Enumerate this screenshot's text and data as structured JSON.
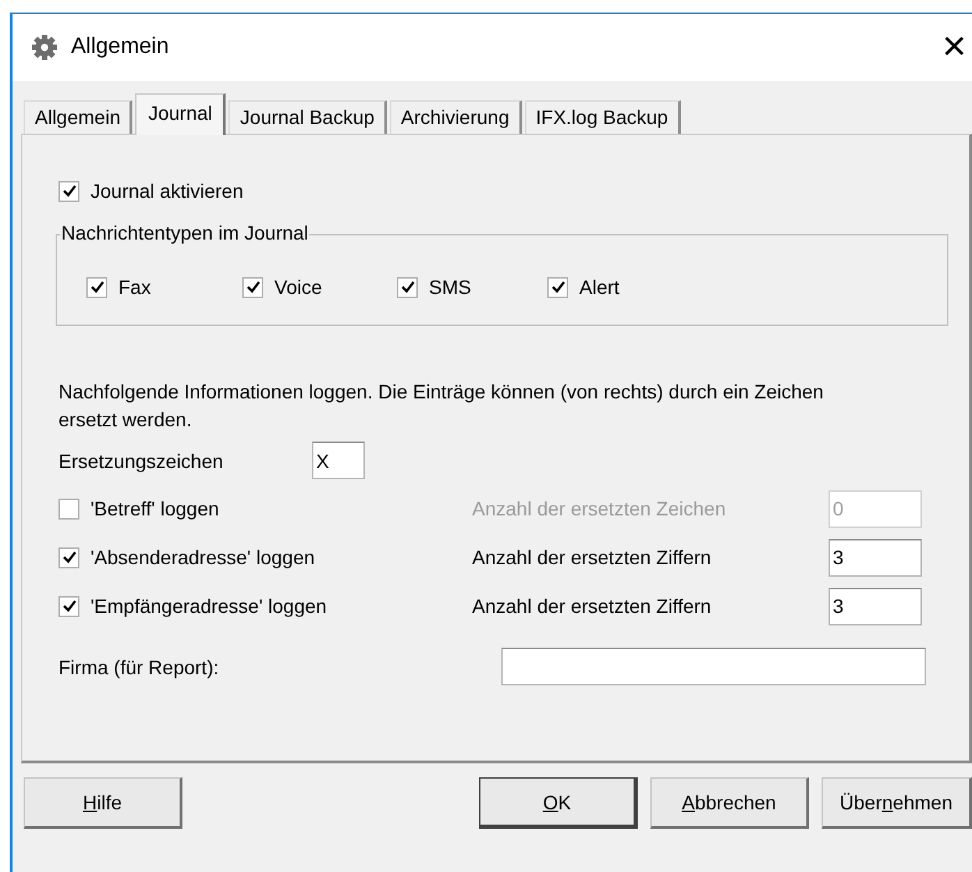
{
  "window": {
    "title": "Allgemein",
    "close": "×"
  },
  "tabs": [
    {
      "label": "Allgemein",
      "selected": false
    },
    {
      "label": "Journal",
      "selected": true
    },
    {
      "label": "Journal Backup",
      "selected": false
    },
    {
      "label": "Archivierung",
      "selected": false
    },
    {
      "label": "IFX.log Backup",
      "selected": false
    }
  ],
  "journal_enable": {
    "label": "Journal aktivieren",
    "checked": true
  },
  "message_types": {
    "title": "Nachrichtentypen im Journal",
    "items": [
      {
        "label": "Fax",
        "checked": true
      },
      {
        "label": "Voice",
        "checked": true
      },
      {
        "label": "SMS",
        "checked": true
      },
      {
        "label": "Alert",
        "checked": true
      }
    ]
  },
  "info_text": "Nachfolgende Informationen loggen. Die Einträge können (von rechts) durch ein Zeichen ersetzt werden.",
  "replacement_char": {
    "label": "Ersetzungszeichen",
    "value": "X"
  },
  "log_rows": [
    {
      "label": "'Betreff' loggen",
      "checked": false,
      "count_label": "Anzahl der ersetzten Zeichen",
      "value": "0",
      "disabled": true
    },
    {
      "label": "'Absenderadresse' loggen",
      "checked": true,
      "count_label": "Anzahl der ersetzten Ziffern",
      "value": "3",
      "disabled": false
    },
    {
      "label": "'Empfängeradresse' loggen",
      "checked": true,
      "count_label": "Anzahl der ersetzten Ziffern",
      "value": "3",
      "disabled": false
    }
  ],
  "company": {
    "label": "Firma (für Report):"
  },
  "buttons": [
    {
      "access": "H",
      "after": "ilfe",
      "kind": "help",
      "default": false
    },
    {
      "access": "O",
      "after": "K",
      "kind": "action",
      "default": true
    },
    {
      "access": "A",
      "after": "bbrechen",
      "kind": "action",
      "default": false
    },
    {
      "before": "Über",
      "access": "n",
      "after": "ehmen",
      "kind": "action",
      "default": false
    }
  ]
}
